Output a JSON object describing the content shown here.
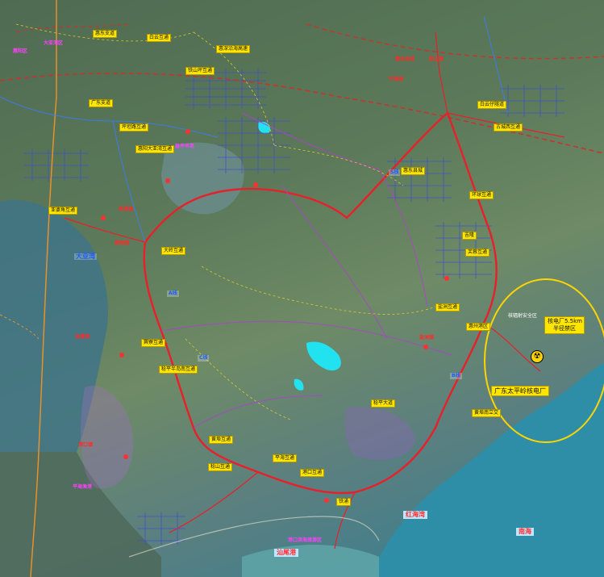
{
  "map": {
    "colors": {
      "road_red": "#e8202a",
      "rail_dash": "#c8342c",
      "urban_grid": "#3c4fd0",
      "sea": "#2f8fa6",
      "protected_purple": "#a070c0",
      "lake_cyan": "#22e2f0",
      "callout_yellow": "#ffe600"
    },
    "labels": {
      "nuclear_plant": "广东太平岭核电厂",
      "nuclear_zone": "核电厂5.5km\n半径禁区",
      "safety_zone": "核辐射安全区",
      "bay_west": "大亚湾",
      "bay_south": "红海湾",
      "south_sea": "南海",
      "south_shore": "汕尾港",
      "honghai_bay": "红海湾"
    },
    "yellow_tags": [
      {
        "id": "t1",
        "text": "惠东支道"
      },
      {
        "id": "t2",
        "text": "白云互通"
      },
      {
        "id": "t3",
        "text": "惠深沿海高速"
      },
      {
        "id": "t4",
        "text": "铁山坪互通"
      },
      {
        "id": "t5",
        "text": "广东支道"
      },
      {
        "id": "t6",
        "text": "坪坦路互通"
      },
      {
        "id": "t7",
        "text": "惠阳大亚湾互通"
      },
      {
        "id": "t8",
        "text": "白云仔隧道"
      },
      {
        "id": "t9",
        "text": "古城西互通"
      },
      {
        "id": "t10",
        "text": "亚婆角互通"
      },
      {
        "id": "t11",
        "text": "大岭互通"
      },
      {
        "id": "t12",
        "text": "环球互通"
      },
      {
        "id": "t13",
        "text": "芙蓉互通"
      },
      {
        "id": "t14",
        "text": "稔平半岛南互通"
      },
      {
        "id": "t15",
        "text": "黄埠互通"
      },
      {
        "id": "t16",
        "text": "平海互通"
      },
      {
        "id": "t17",
        "text": "港口互通"
      },
      {
        "id": "t18",
        "text": "稔山互通"
      },
      {
        "id": "t19",
        "text": "盐洲互通"
      },
      {
        "id": "t20",
        "text": "巽寮互通"
      },
      {
        "id": "t21",
        "text": "黄埠南立交"
      },
      {
        "id": "t22",
        "text": "稔平大道"
      },
      {
        "id": "t23",
        "text": "惠州港区"
      },
      {
        "id": "t24",
        "text": "惠东县城"
      },
      {
        "id": "t25",
        "text": "吉隆"
      },
      {
        "id": "t26",
        "text": "铁涌"
      }
    ],
    "red_labels": [
      "惠东县城",
      "稔山镇",
      "平海镇",
      "黄埠镇",
      "吉隆镇",
      "盐洲镇",
      "铁涌镇",
      "港口镇"
    ],
    "magenta_labels": [
      "大亚湾区",
      "惠阳区",
      "平海渔港",
      "港口滨海旅游区",
      "稔平半岛"
    ],
    "blue_labels": [
      "S线",
      "B线",
      "A线",
      "C线"
    ]
  }
}
